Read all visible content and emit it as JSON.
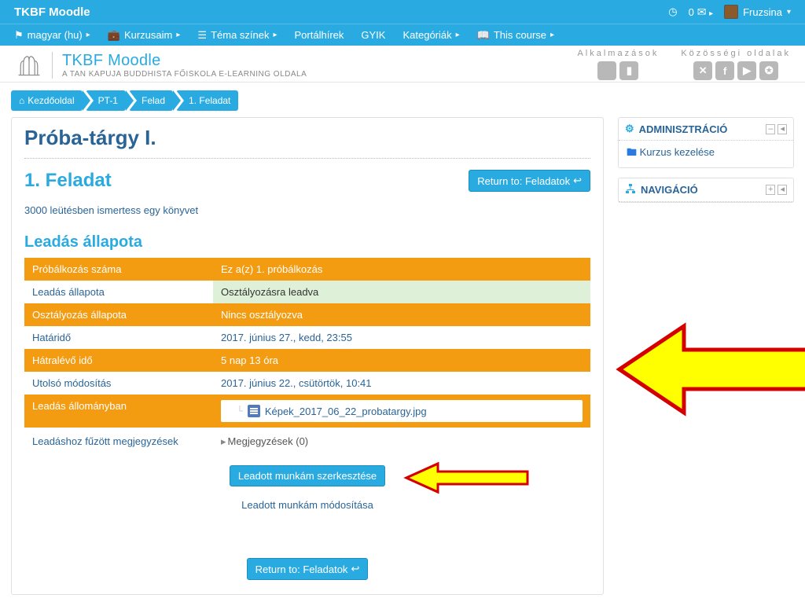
{
  "topbar": {
    "brand": "TKBF Moodle",
    "msg_count": "0",
    "user_name": "Fruzsina"
  },
  "menu": {
    "lang": "magyar (hu)",
    "courses": "Kurzusaim",
    "themes": "Téma színek",
    "news": "Portálhírek",
    "faq": "GYIK",
    "categories": "Kategóriák",
    "thiscourse": "This course"
  },
  "banner": {
    "title": "TKBF Moodle",
    "subtitle": "A TAN KAPUJA BUDDHISTA FŐISKOLA E-LEARNING OLDALA",
    "apps_label": "Alkalmazások",
    "social_label": "Közösségi oldalak"
  },
  "breadcrumb": {
    "home": "Kezdőoldal",
    "course": "PT-1",
    "section": "Felad",
    "item": "1. Feladat"
  },
  "main": {
    "course_title": "Próba-tárgy I.",
    "assignment_title": "1. Feladat",
    "return_label": "Return to: Feladatok",
    "description": "3000 leütésben ismertess egy könyvet",
    "status_heading": "Leadás állapota",
    "rows": {
      "attempt_l": "Próbálkozás száma",
      "attempt_v": "Ez a(z) 1. próbálkozás",
      "substat_l": "Leadás állapota",
      "substat_v": "Osztályozásra leadva",
      "grade_l": "Osztályozás állapota",
      "grade_v": "Nincs osztályozva",
      "due_l": "Határidő",
      "due_v": "2017. június 27., kedd, 23:55",
      "remain_l": "Hátralévő idő",
      "remain_v": "5 nap 13 óra",
      "lastmod_l": "Utolsó módosítás",
      "lastmod_v": "2017. június 22., csütörtök, 10:41",
      "files_l": "Leadás állományban",
      "file_name": "Képek_2017_06_22_probatargy.jpg",
      "comments_l": "Leadáshoz fűzött megjegyzések",
      "comments_v": "Megjegyzések (0)"
    },
    "edit_btn": "Leadott munkám szerkesztése",
    "edit_sub": "Leadott munkám módosítása",
    "return_bottom": "Return to: Feladatok"
  },
  "side": {
    "admin_title": "ADMINISZTRÁCIÓ",
    "admin_item": "Kurzus kezelése",
    "nav_title": "NAVIGÁCIÓ"
  }
}
